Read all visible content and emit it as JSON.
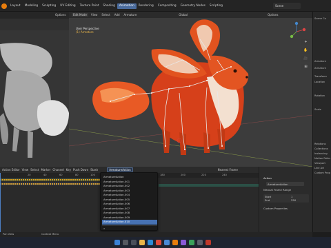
{
  "topbar": {
    "menus": [
      "Layout",
      "Modeling",
      "Sculpting",
      "UV Editing",
      "Texture Paint",
      "Shading",
      "Animation",
      "Rendering",
      "Compositing",
      "Geometry Nodes",
      "Scripting"
    ],
    "active_menu": "Animation",
    "scene": "Scene"
  },
  "left_header": {
    "options": "Options"
  },
  "viewport": {
    "mode": "Edit Mode",
    "menu": [
      "View",
      "Select",
      "Add",
      "Armature"
    ],
    "transform": "Global",
    "options": "Options",
    "info_line1": "User Perspective",
    "info_line2": "(1) Armature"
  },
  "right_tools": [
    "+",
    "✋",
    "🎥",
    "⊞"
  ],
  "properties": {
    "items": [
      "Scene Co",
      "Armature",
      "Armature",
      "Transform",
      "Location",
      "Rotation",
      "Scale",
      "Relations",
      "Collections",
      "Instancing",
      "Motion Paths",
      "Viewport",
      "Line Art",
      "Custom Prop"
    ]
  },
  "dopesheet": {
    "editor": "Action Editor",
    "menus": [
      "View",
      "Select",
      "Marker",
      "Channel",
      "Key"
    ],
    "push_down": "Push Down",
    "stash": "Stash",
    "action": "ArmatureAction",
    "interpolation": "Nearest Frame",
    "ruler": [
      "20",
      "40",
      "60",
      "80",
      "100",
      "120",
      "140",
      "160",
      "180",
      "200",
      "220",
      "240"
    ]
  },
  "dropdown": {
    "items": [
      "ArmatureAction",
      "ArmatureAction.001",
      "ArmatureAction.002",
      "ArmatureAction.003",
      "ArmatureAction.004",
      "ArmatureAction.005",
      "ArmatureAction.006",
      "ArmatureAction.007",
      "ArmatureAction.008",
      "ArmatureAction.009",
      "ArmatureAction.010"
    ],
    "highlighted_index": 10,
    "search_placeholder": ""
  },
  "action_panel": {
    "title": "Action",
    "action_name": "ArmatureAction",
    "manual_frame_range": "Manual Frame Range",
    "custom_props": "Custom Properties",
    "start_label": "Start",
    "start_value": "1",
    "end_label": "End",
    "end_value": "250"
  },
  "status_bar": {
    "left": "Pan View",
    "middle": "Context Menu"
  },
  "colors": {
    "accent": "#4772b3",
    "active_tab": "#4a6b9c",
    "keyframes": "#e0a21a"
  }
}
